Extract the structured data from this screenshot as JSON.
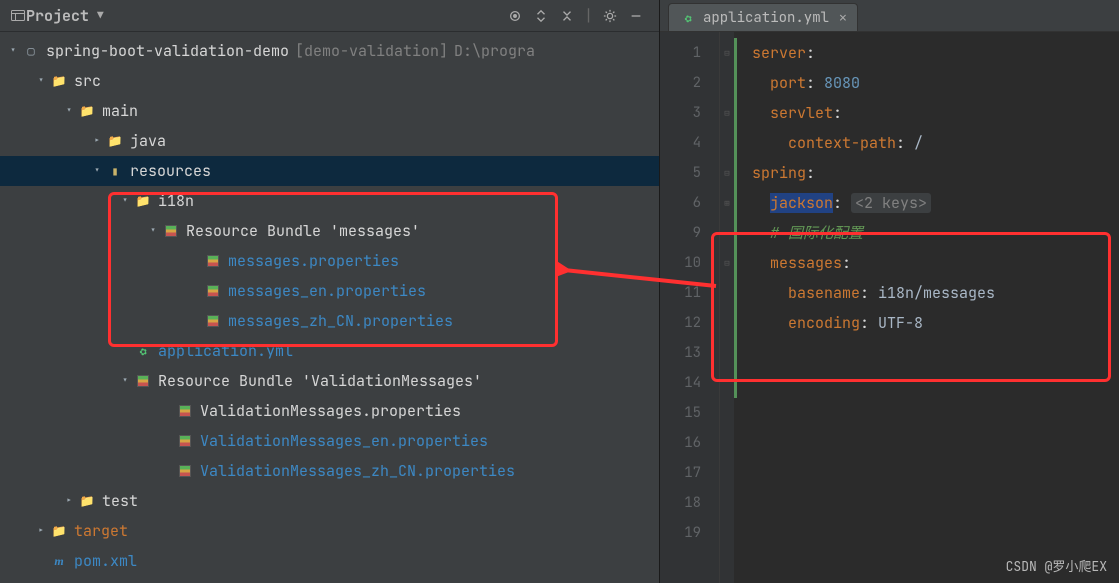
{
  "toolbar": {
    "title": "Project"
  },
  "tree": {
    "root_name": "spring-boot-validation-demo",
    "root_module": "[demo-validation]",
    "root_path": "D:\\progra",
    "src": "src",
    "main": "main",
    "java": "java",
    "resources": "resources",
    "i18n": "i18n",
    "bundle_msg": "Resource Bundle 'messages'",
    "msg_p": "messages.properties",
    "msg_en": "messages_en.properties",
    "msg_zh": "messages_zh_CN.properties",
    "app_yml": "application.yml",
    "bundle_val": "Resource Bundle 'ValidationMessages'",
    "val_p": "ValidationMessages.properties",
    "val_en": "ValidationMessages_en.properties",
    "val_zh": "ValidationMessages_zh_CN.properties",
    "test": "test",
    "target": "target",
    "pom": "pom.xml"
  },
  "editor": {
    "tab_name": "application.yml",
    "gutter": [
      "1",
      "2",
      "3",
      "4",
      "5",
      "6",
      "9",
      "10",
      "11",
      "12",
      "13",
      "14",
      "15",
      "16",
      "17",
      "18",
      "19"
    ],
    "lines": {
      "l1k": "server",
      "l1c": ":",
      "l2k": "port",
      "l2c": ": ",
      "l2v": "8080",
      "l3k": "servlet",
      "l3c": ":",
      "l4k": "context-path",
      "l4c": ": ",
      "l4v": "/",
      "l5k": "spring",
      "l5c": ":",
      "l6k": "jackson",
      "l6c": ": ",
      "l6f": "<2 keys>",
      "l9c": "# 国际化配置",
      "l10k": "messages",
      "l10c": ":",
      "l11k": "basename",
      "l11c": ": ",
      "l11v": "i18n/messages",
      "l12k": "encoding",
      "l12c": ": ",
      "l12v": "UTF-8"
    }
  },
  "watermark": "CSDN @罗小爬EX"
}
